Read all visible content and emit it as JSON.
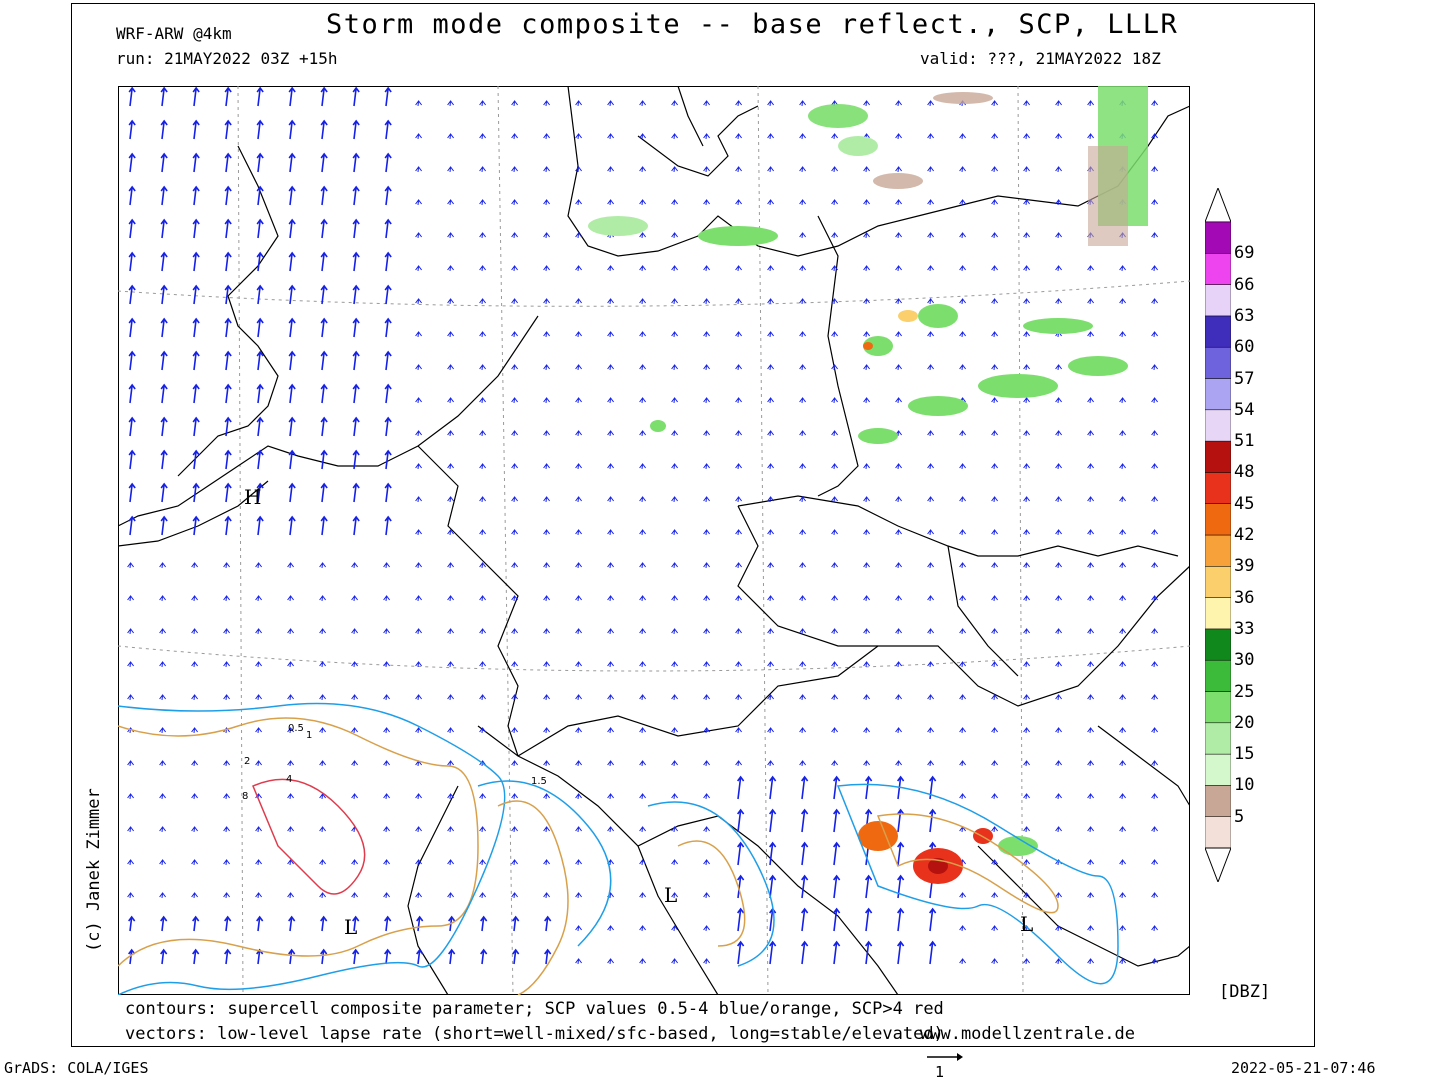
{
  "header": {
    "title": "Storm mode composite -- base reflect., SCP, LLLR",
    "model": "WRF-ARW @4km",
    "run": "run: 21MAY2022 03Z +15h",
    "valid": "valid: ???, 21MAY2022 18Z"
  },
  "footer": {
    "contours": "contours: supercell composite parameter; SCP values 0.5-4 blue/orange, SCP>4 red",
    "vectors": "vectors: low-level lapse rate (short=well-mixed/sfc-based, long=stable/elevated)",
    "watermark": "www.modellzentrale.de",
    "grads": "GrADS: COLA/IGES",
    "timestamp": "2022-05-21-07:46",
    "vector_scale": "1"
  },
  "copyright": "(c) Janek Zimmer",
  "legend": {
    "unit": "[DBZ]",
    "levels": [
      "5",
      "10",
      "15",
      "20",
      "25",
      "30",
      "33",
      "36",
      "39",
      "42",
      "45",
      "48",
      "51",
      "54",
      "57",
      "60",
      "63",
      "66",
      "69"
    ],
    "colors": [
      "#f3e1d9",
      "#c8a796",
      "#d5f7cc",
      "#b1eca7",
      "#7cde6d",
      "#3cba3a",
      "#11881c",
      "#fff4ad",
      "#fbcf6c",
      "#f6a13a",
      "#ef6911",
      "#e8321c",
      "#b5120f",
      "#e7d6f5",
      "#aaa4f2",
      "#6f63dd",
      "#3f2dbb",
      "#e6d3f7",
      "#ee44ef",
      "#a309b5"
    ]
  },
  "map": {
    "pressure_centers": [
      "H",
      "L",
      "L",
      "L"
    ],
    "contour_labels": [
      "0.5",
      "1",
      "2",
      "4",
      "8",
      "1.5"
    ],
    "colors": {
      "coast": "#000000",
      "vector": "#1621e6",
      "scp_low": "#1f9ee8",
      "scp_mid": "#d8a04a",
      "scp_high": "#df3b4c",
      "grid": "#9a9a9a"
    }
  }
}
